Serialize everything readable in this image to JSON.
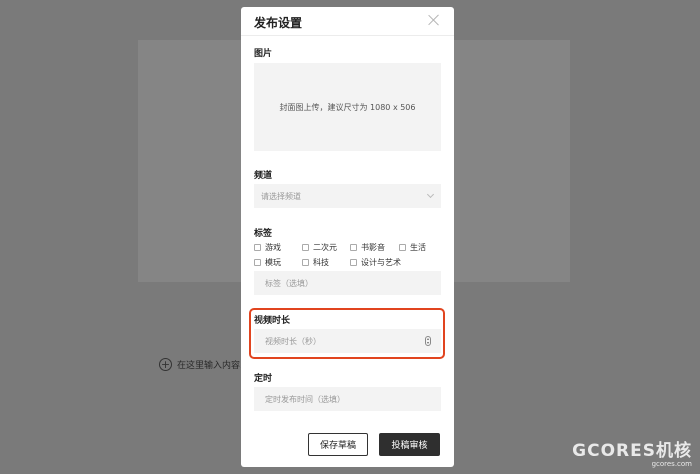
{
  "background": {
    "add_content_text": "在这里输入内容..."
  },
  "watermark": {
    "logo": "GCORES机核",
    "sub": "gcores.com"
  },
  "modal": {
    "title": "发布设置",
    "image_section": {
      "label": "图片",
      "upload_hint": "封面图上传，建议尺寸为 1080 x 506"
    },
    "channel_section": {
      "label": "频道",
      "placeholder": "请选择频道"
    },
    "tags_section": {
      "label": "标签",
      "options": [
        "游戏",
        "二次元",
        "书影音",
        "生活",
        "模玩",
        "科技",
        "设计与艺术"
      ],
      "input_placeholder": "标签（选填）"
    },
    "duration_section": {
      "label": "视频时长",
      "placeholder": "视频时长（秒）"
    },
    "schedule_section": {
      "label": "定时",
      "placeholder": "定时发布时间（选填）"
    },
    "buttons": {
      "save_draft": "保存草稿",
      "submit_review": "投稿审核"
    }
  },
  "colors": {
    "highlight_border": "#e1441f",
    "primary_button": "#2f2f2f",
    "field_background": "#f3f3f3"
  }
}
